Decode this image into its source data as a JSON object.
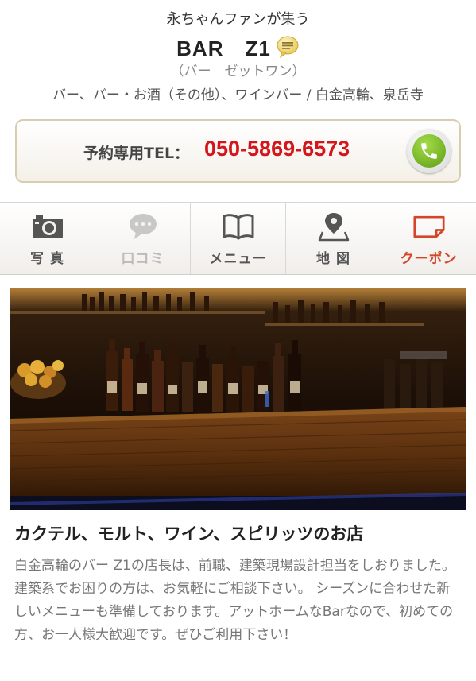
{
  "header": {
    "tagline": "永ちゃんファンが集う",
    "shop_name": "BAR　Z1",
    "reading": "（バー　ゼットワン）",
    "genre": "バー、バー・お酒（その他）、ワインバー / 白金高輪、泉岳寺"
  },
  "tel": {
    "label": "予約専用TEL：",
    "number": "050-5869-6573",
    "icon": "phone-icon"
  },
  "tabs": [
    {
      "label": "写 真",
      "icon": "camera-icon",
      "enabled": true
    },
    {
      "label": "口コミ",
      "icon": "speech-bubble-icon",
      "enabled": false
    },
    {
      "label": "メニュー",
      "icon": "book-icon",
      "enabled": true
    },
    {
      "label": "地 図",
      "icon": "map-pin-icon",
      "enabled": true
    },
    {
      "label": "クーポン",
      "icon": "coupon-icon",
      "enabled": true
    }
  ],
  "catch": "カクテル、モルト、ワイン、スピリッツのお店",
  "description": "白金高輪のバー Z1の店長は、前職、建築現場設計担当をしおりました。 建築系でお困りの方は、お気軽にご相談下さい。 シーズンに合わせた新しいメニューも準備しております。アットホームなBarなので、初めての方、お一人様大歓迎です。ぜひご利用下さい！",
  "colors": {
    "accent_red": "#d4151b",
    "phone_green": "#6aaa1c",
    "coupon_orange": "#d4452a"
  }
}
